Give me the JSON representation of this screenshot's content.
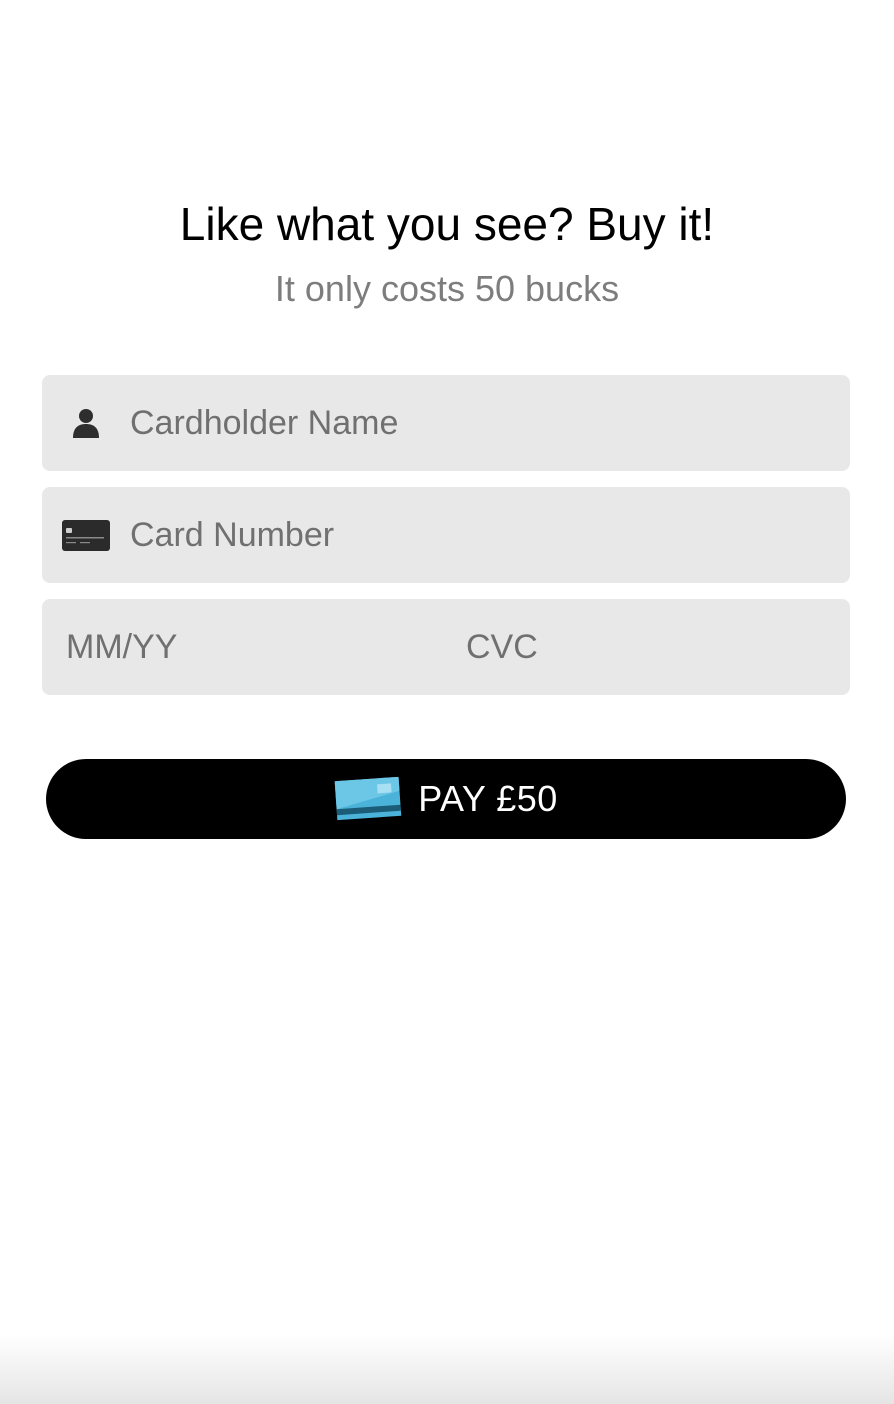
{
  "header": {
    "title": "Like what you see? Buy it!",
    "subtitle": "It only costs 50 bucks"
  },
  "form": {
    "cardholder_name": {
      "value": "",
      "placeholder": "Cardholder Name",
      "icon": "person-icon"
    },
    "card_number": {
      "value": "",
      "placeholder": "Card Number",
      "icon": "credit-card-icon"
    },
    "expiry": {
      "value": "",
      "placeholder": "MM/YY"
    },
    "cvc": {
      "value": "",
      "placeholder": "CVC"
    }
  },
  "pay_button": {
    "label": "PAY £50",
    "icon": "credit-card-icon"
  },
  "colors": {
    "field_background": "#e8e8e8",
    "button_background": "#000000",
    "button_text": "#ffffff",
    "subtitle_text": "#7d7d7d",
    "card_icon_accent": "#4bb3d9"
  }
}
